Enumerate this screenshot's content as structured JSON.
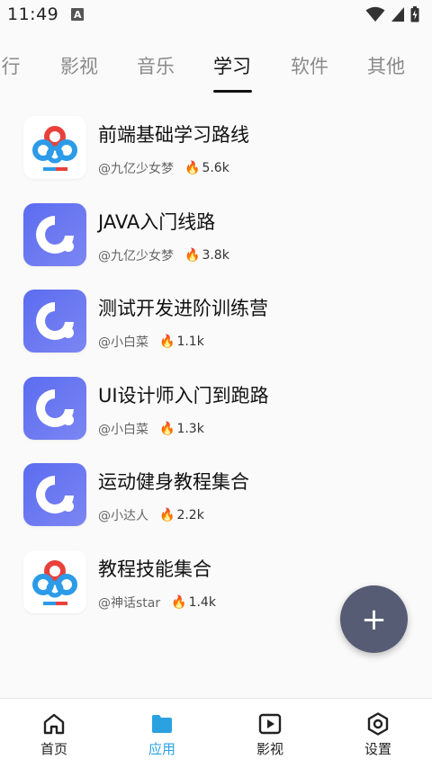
{
  "status_bar": {
    "time": "11:49",
    "notification_badge": "A"
  },
  "tabs": [
    {
      "label": "行",
      "active": false
    },
    {
      "label": "影视",
      "active": false
    },
    {
      "label": "音乐",
      "active": false
    },
    {
      "label": "学习",
      "active": true
    },
    {
      "label": "软件",
      "active": false
    },
    {
      "label": "其他",
      "active": false
    }
  ],
  "items": [
    {
      "title": "前端基础学习路线",
      "author": "@九亿少女梦",
      "count": "5.6k",
      "icon": "cloud-logo-icon"
    },
    {
      "title": "JAVA入门线路",
      "author": "@九亿少女梦",
      "count": "3.8k",
      "icon": "ring-logo-icon"
    },
    {
      "title": "测试开发进阶训练营",
      "author": "@小白菜",
      "count": "1.1k",
      "icon": "ring-logo-icon"
    },
    {
      "title": "UI设计师入门到跑路",
      "author": "@小白菜",
      "count": "1.3k",
      "icon": "ring-logo-icon"
    },
    {
      "title": "运动健身教程集合",
      "author": "@小达人",
      "count": "2.2k",
      "icon": "ring-logo-icon"
    },
    {
      "title": "教程技能集合",
      "author": "@神话star",
      "count": "1.4k",
      "icon": "cloud-logo-icon"
    }
  ],
  "fab": {
    "label": "+"
  },
  "nav": [
    {
      "label": "首页",
      "icon": "home-icon",
      "active": false
    },
    {
      "label": "应用",
      "icon": "folder-icon",
      "active": true
    },
    {
      "label": "影视",
      "icon": "play-icon",
      "active": false
    },
    {
      "label": "设置",
      "icon": "settings-icon",
      "active": false
    }
  ],
  "colors": {
    "accent": "#2aa2e0",
    "fab": "#565c73",
    "ring_icon_bg": "#6f7ef0"
  }
}
